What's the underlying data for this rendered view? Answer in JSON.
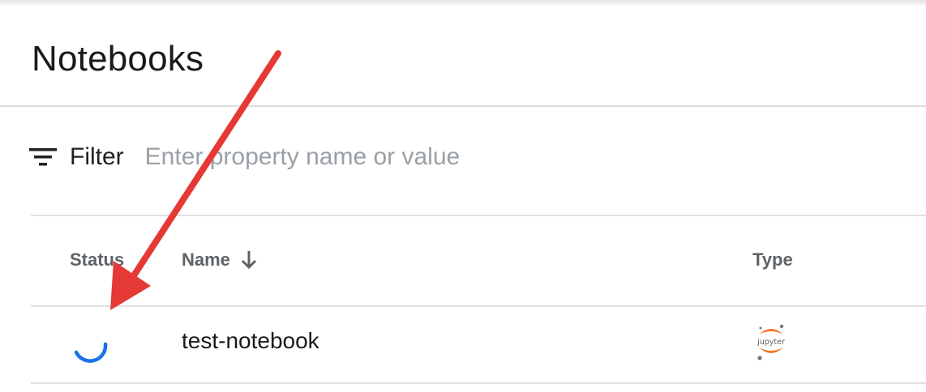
{
  "header": {
    "title": "Notebooks"
  },
  "filter": {
    "label": "Filter",
    "placeholder": "Enter property name or value"
  },
  "table": {
    "columns": {
      "status": "Status",
      "name": "Name",
      "type": "Type"
    },
    "rows": [
      {
        "status": "loading",
        "name": "test-notebook",
        "type_logo_text": "jupyter"
      }
    ]
  },
  "colors": {
    "spinner": "#1a73e8",
    "jupyter_orange": "#f37726",
    "annotation_arrow": "#e53935"
  },
  "icons": {
    "filter": "filter-list-icon",
    "sort": "arrow-down-icon",
    "status": "spinner-icon",
    "type": "jupyter-logo-icon",
    "annotation": "red-arrow"
  }
}
